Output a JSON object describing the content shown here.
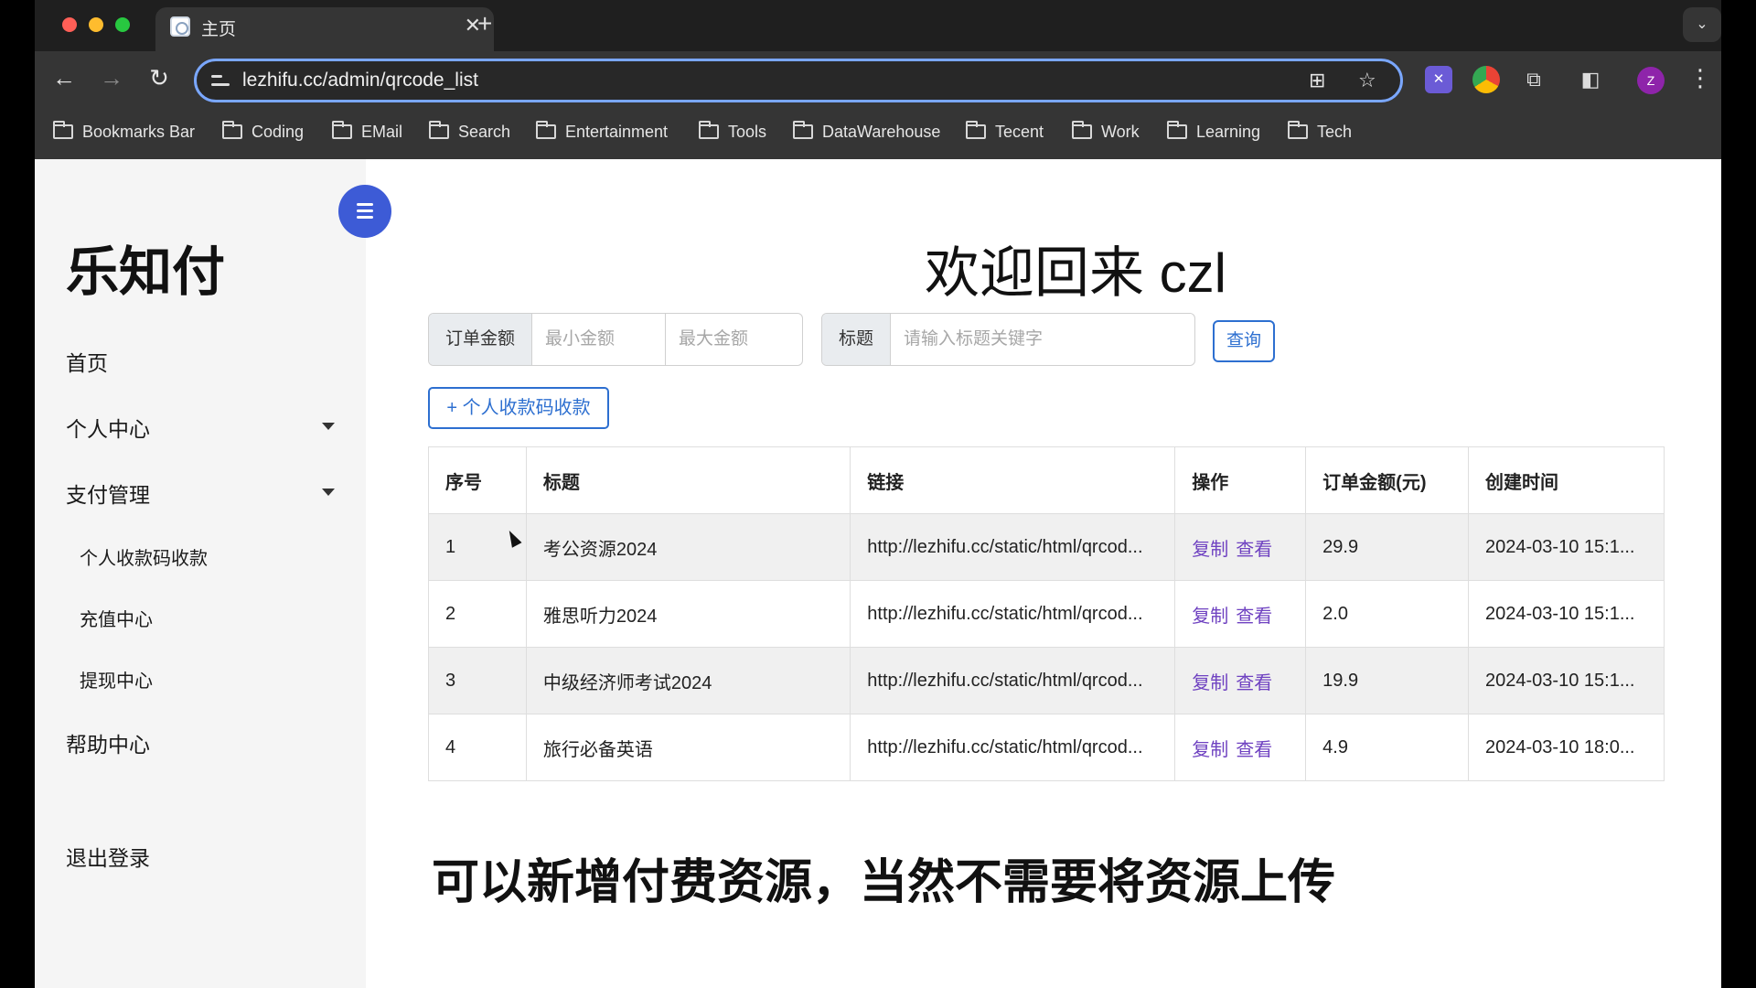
{
  "browser": {
    "tab_title": "主页",
    "tab_close": "✕",
    "new_tab": "+",
    "tab_list": "⌄",
    "url": "lezhifu.cc/admin/qrcode_list",
    "profile_initial": "Z",
    "bookmarks": [
      "Bookmarks Bar",
      "Coding",
      "EMail",
      "Search",
      "Entertainment",
      "Tools",
      "DataWarehouse",
      "Tecent",
      "Work",
      "Learning",
      "Tech"
    ]
  },
  "sidebar": {
    "brand": "乐知付",
    "items": {
      "home": "首页",
      "personal_center": "个人中心",
      "payment_management": "支付管理",
      "qrcode_collection": "个人收款码收款",
      "recharge_center": "充值中心",
      "withdraw_center": "提现中心",
      "help_center": "帮助中心",
      "logout": "退出登录"
    }
  },
  "main": {
    "welcome": "欢迎回来 czl",
    "filter": {
      "amount_label": "订单金额",
      "min_placeholder": "最小金额",
      "max_placeholder": "最大金额",
      "title_label": "标题",
      "title_placeholder": "请输入标题关键字",
      "query_button": "查询"
    },
    "add_button": "+  个人收款码收款",
    "table": {
      "headers": [
        "序号",
        "标题",
        "链接",
        "操作",
        "订单金额(元)",
        "创建时间"
      ],
      "action_copy": "复制",
      "action_view": "查看",
      "rows": [
        {
          "no": "1",
          "title": "考公资源2024",
          "link": "http://lezhifu.cc/static/html/qrcod...",
          "amount": "29.9",
          "created": "2024-03-10 15:1..."
        },
        {
          "no": "2",
          "title": "雅思听力2024",
          "link": "http://lezhifu.cc/static/html/qrcod...",
          "amount": "2.0",
          "created": "2024-03-10 15:1..."
        },
        {
          "no": "3",
          "title": "中级经济师考试2024",
          "link": "http://lezhifu.cc/static/html/qrcod...",
          "amount": "19.9",
          "created": "2024-03-10 15:1..."
        },
        {
          "no": "4",
          "title": "旅行必备英语",
          "link": "http://lezhifu.cc/static/html/qrcod...",
          "amount": "4.9",
          "created": "2024-03-10 18:0..."
        }
      ]
    },
    "caption": "可以新增付费资源，当然不需要将资源上传"
  },
  "colors": {
    "accent": "#2d6fd0",
    "menu_button": "#3d5bd6",
    "action_link": "#6f42c1",
    "sidebar_bg": "#f5f5f5"
  }
}
